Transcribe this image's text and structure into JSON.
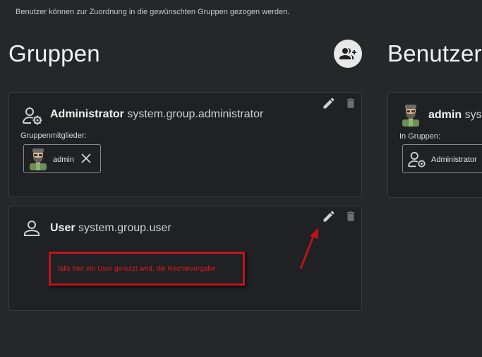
{
  "hint": "Benutzer können zur Zuordnung in die gewünschten Gruppen gezogen werden.",
  "groups_heading": "Gruppen",
  "users_heading": "Benutzer",
  "groups": [
    {
      "name": "Administrator",
      "id": "system.group.administrator",
      "members_label": "Gruppenmitglieder:",
      "member": "admin"
    },
    {
      "name": "User",
      "id": "system.group.user"
    }
  ],
  "user_card": {
    "name": "admin",
    "id_partial": "sys",
    "groups_label": "In Gruppen:",
    "group": "Administrator"
  },
  "annotation": {
    "text": "falls hier ein User genutzt wird, die Rechtevergabe",
    "color": "#d4111a"
  },
  "colors": {
    "background": "#25272a",
    "card": "#1f2124",
    "card_border": "#3a3d41",
    "add_button": "#e8e8e8"
  },
  "icons": [
    "group-add-icon",
    "edit-icon",
    "delete-icon",
    "group-settings-icon",
    "person-icon",
    "close-icon",
    "avatar"
  ]
}
